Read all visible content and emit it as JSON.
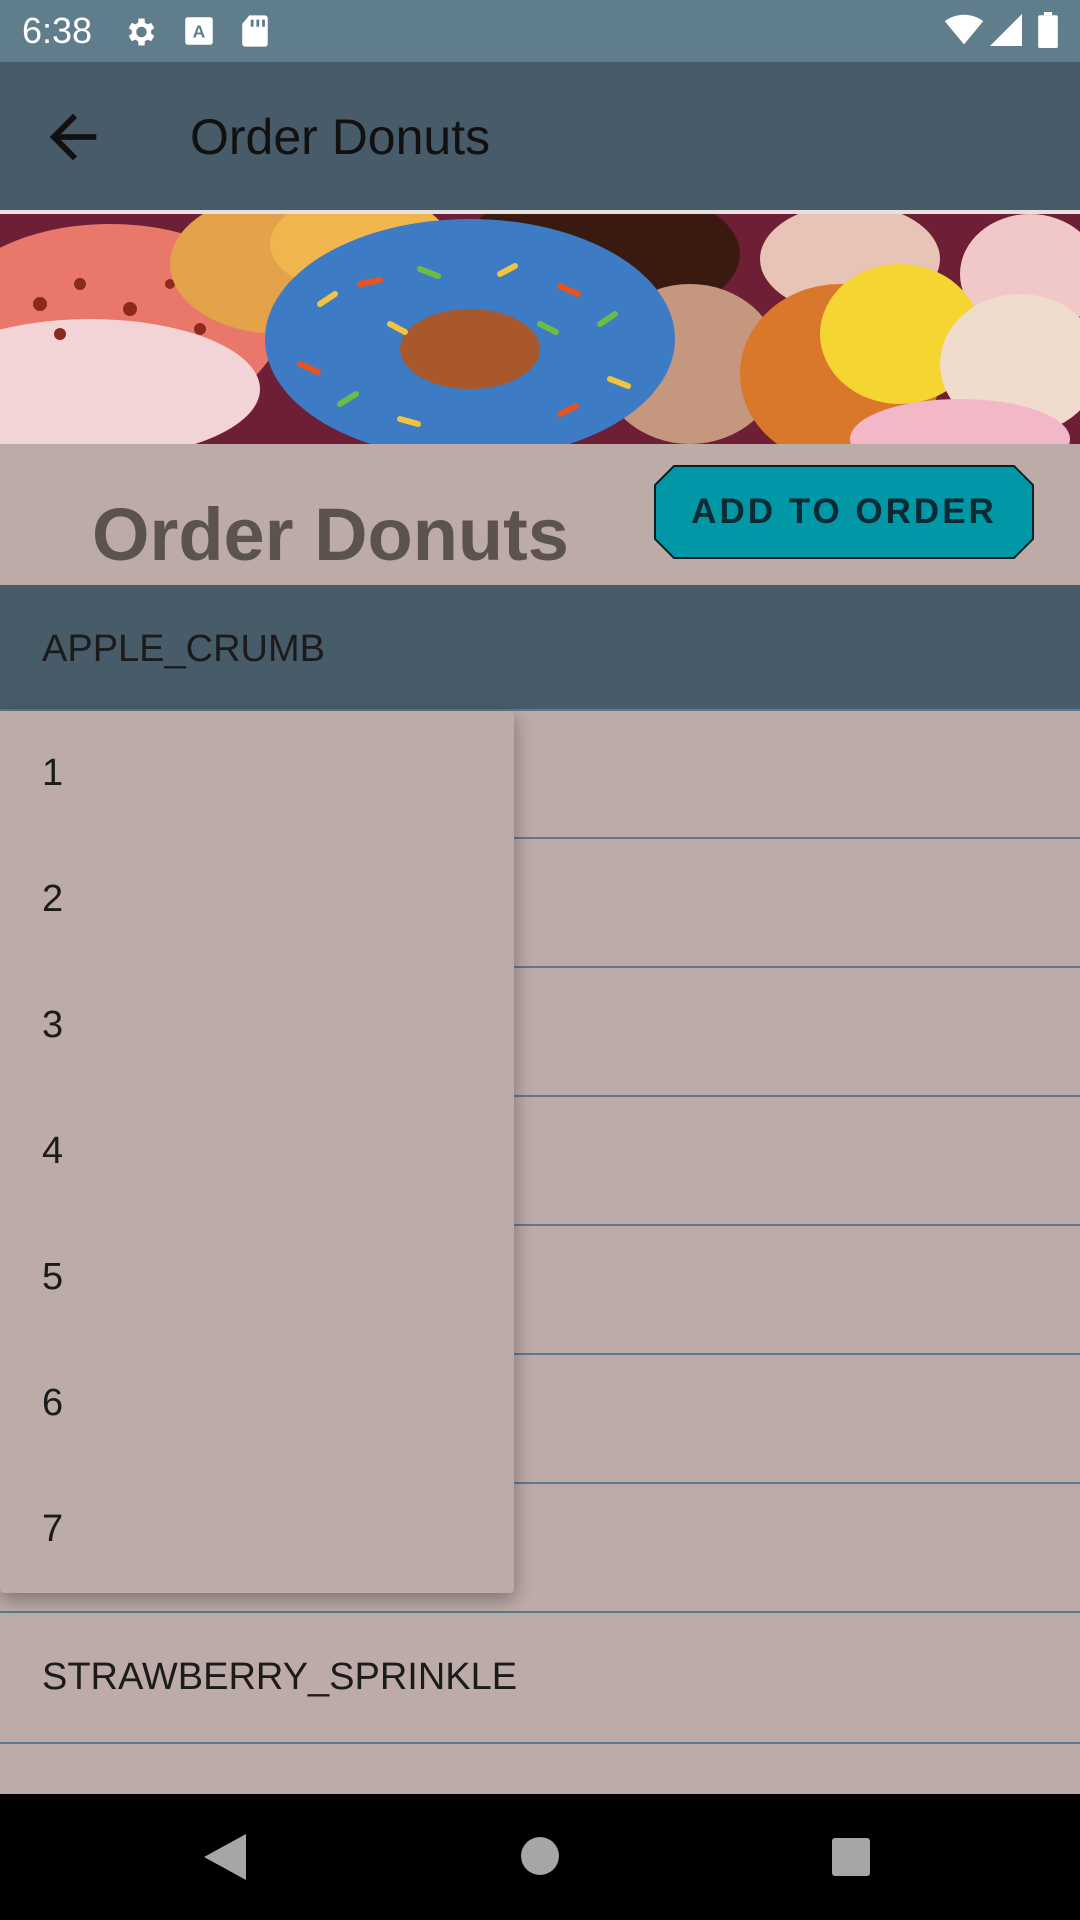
{
  "status_bar": {
    "time": "6:38",
    "icons": [
      "gear-icon",
      "keyboard-a-icon",
      "sd-card-icon",
      "wifi-icon",
      "signal-icon",
      "battery-icon"
    ]
  },
  "app_bar": {
    "title": "Order Donuts",
    "back_icon": "arrow-back-icon"
  },
  "header": {
    "title": "Order Donuts",
    "add_button_label": "ADD TO ORDER"
  },
  "donut_list": {
    "selected": "APPLE_CRUMB",
    "last_visible": "STRAWBERRY_SPRINKLE"
  },
  "quantity_dropdown": {
    "options": [
      "1",
      "2",
      "3",
      "4",
      "5",
      "6",
      "7"
    ]
  },
  "nav_bar": {
    "icons": [
      "back-triangle-icon",
      "home-circle-icon",
      "recents-square-icon"
    ]
  },
  "colors": {
    "status_bar": "#607d8b",
    "app_bar": "#485b68",
    "background": "#bcaba6",
    "button": "#0097a7",
    "divider": "#5a7a90"
  }
}
